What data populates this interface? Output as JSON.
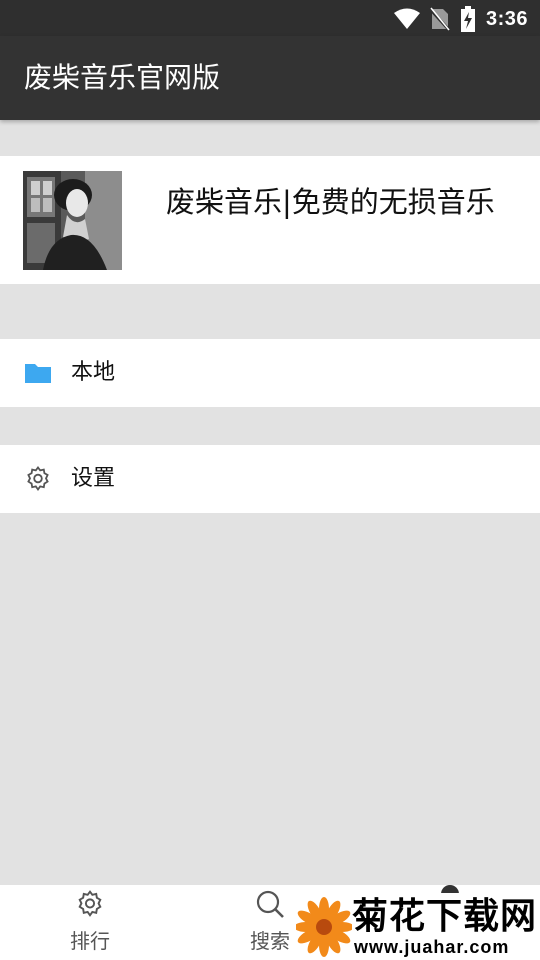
{
  "status_bar": {
    "time": "3:36",
    "icons": [
      "wifi-icon",
      "no-sim-icon",
      "battery-charging-icon"
    ]
  },
  "app_bar": {
    "title": "废柴音乐官网版"
  },
  "profile": {
    "avatar": "avatar-photo",
    "name": "废柴音乐|免费的无损音乐"
  },
  "menu": [
    {
      "icon": "folder-icon",
      "label": "本地",
      "color": "#3da8f0"
    },
    {
      "icon": "gear-icon",
      "label": "设置"
    }
  ],
  "tabs": [
    {
      "icon": "settings-tab-icon",
      "label": "排行"
    },
    {
      "icon": "search-icon",
      "label": "搜索"
    },
    {
      "icon": "person-icon",
      "label": ""
    }
  ],
  "watermark": {
    "text": "菊花下载网",
    "url": "www.juahar.com"
  },
  "colors": {
    "status_bar": "#2f2f2f",
    "app_bar": "#333333",
    "background": "#e2e2e2",
    "accent_folder": "#3da8f0"
  }
}
